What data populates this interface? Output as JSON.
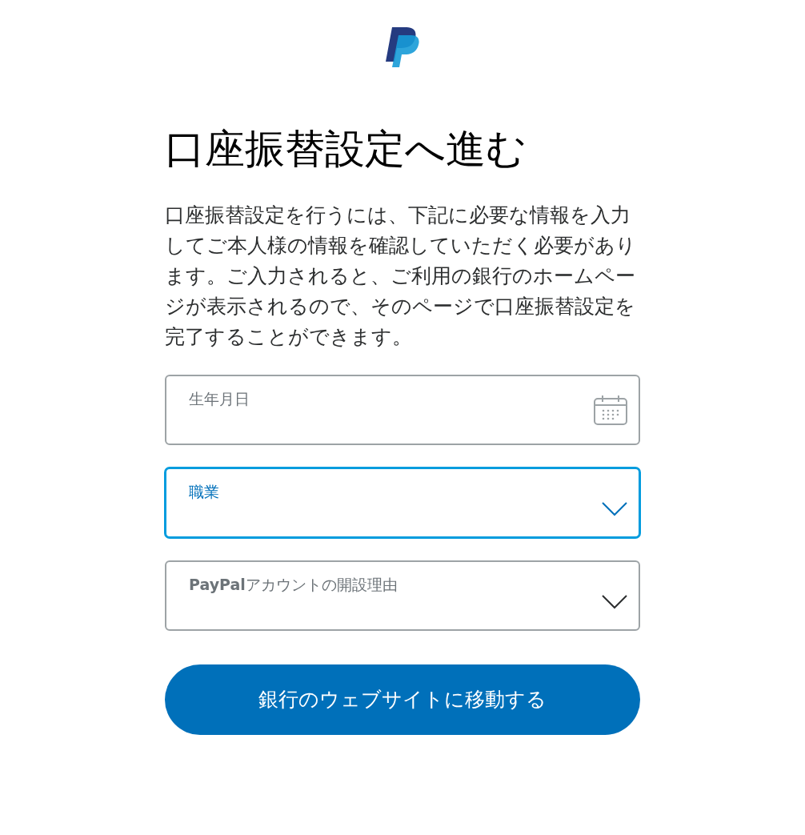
{
  "title": "口座振替設定へ進む",
  "description": "口座振替設定を行うには、下記に必要な情報を入力してご本人様の情報を確認していただく必要があります。ご入力されると、ご利用の銀行のホームページが表示されるので、そのページで口座振替設定を完了することができます。",
  "fields": [
    {
      "kind": "date",
      "label": "生年月日",
      "focused": false
    },
    {
      "kind": "select",
      "label": "職業",
      "focused": true
    },
    {
      "kind": "select",
      "label": "**PayPal**アカウントの開設理由",
      "focused": false
    }
  ],
  "button": "銀行のウェブサイトに移動する"
}
